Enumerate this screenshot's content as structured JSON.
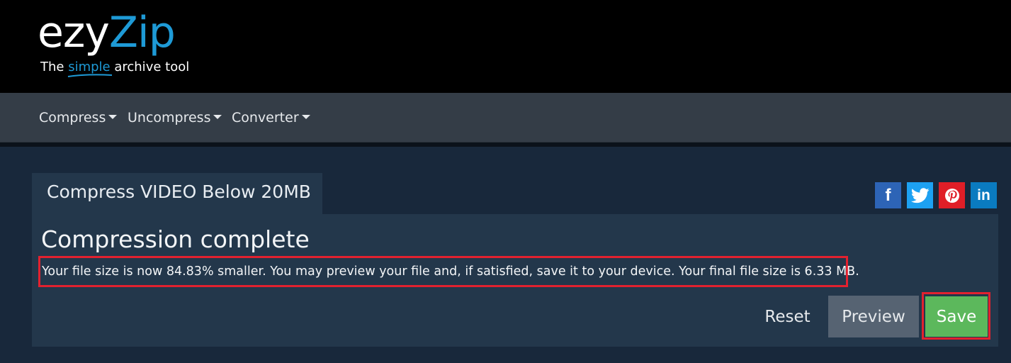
{
  "logo": {
    "name_part1": "ezy",
    "name_part2": "Zip",
    "tagline_before": "The ",
    "tagline_accent": "simple",
    "tagline_after": " archive tool"
  },
  "nav": {
    "items": [
      {
        "label": "Compress"
      },
      {
        "label": "Uncompress"
      },
      {
        "label": "Converter"
      }
    ]
  },
  "tab": {
    "title": "Compress VIDEO Below 20MB"
  },
  "social": {
    "facebook": "f",
    "linkedin": "in"
  },
  "result": {
    "heading": "Compression complete",
    "message": "Your file size is now 84.83% smaller. You may preview your file and, if satisfied, save it to your device. Your final file size is 6.33 MB."
  },
  "actions": {
    "reset": "Reset",
    "preview": "Preview",
    "save": "Save"
  },
  "colors": {
    "accent": "#1e9ad6",
    "save": "#5cb85c",
    "highlight": "#e2212f",
    "panel": "#23374b"
  }
}
